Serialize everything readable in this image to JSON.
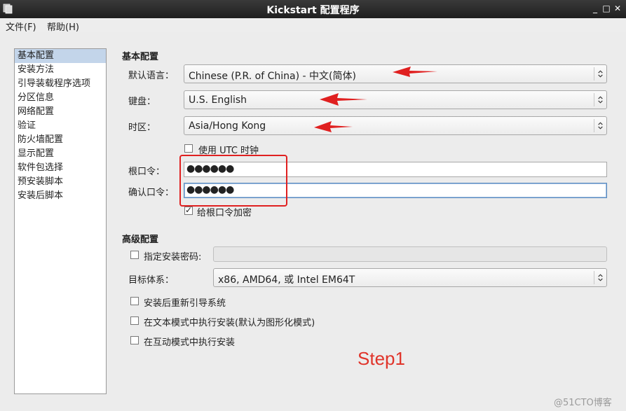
{
  "window": {
    "title": "Kickstart 配置程序",
    "controls": [
      "_",
      "□",
      "✕"
    ]
  },
  "menubar": {
    "file": "文件(F)",
    "help": "帮助(H)"
  },
  "sidebar": {
    "items": [
      "基本配置",
      "安装方法",
      "引导装载程序选项",
      "分区信息",
      "网络配置",
      "验证",
      "防火墙配置",
      "显示配置",
      "软件包选择",
      "预安装脚本",
      "安装后脚本"
    ],
    "selected_index": 0
  },
  "basic": {
    "section_title": "基本配置",
    "language_label": "默认语言：",
    "language_value": "Chinese (P.R. of China) - 中文(简体)",
    "keyboard_label": "键盘：",
    "keyboard_value": "U.S. English",
    "timezone_label": "时区：",
    "timezone_value": "Asia/Hong Kong",
    "utc_label": "使用 UTC 时钟",
    "utc_checked": false,
    "root_pw_label": "根口令：",
    "root_pw_value": "●●●●●●",
    "confirm_pw_label": "确认口令：",
    "confirm_pw_value": "●●●●●●",
    "encrypt_label": "给根口令加密",
    "encrypt_checked": true
  },
  "advanced": {
    "section_title": "高级配置",
    "install_key_label": "指定安装密码:",
    "install_key_checked": false,
    "target_arch_label": "目标体系：",
    "target_arch_value": "x86, AMD64, 或  Intel EM64T",
    "reboot_label": "安装后重新引导系统",
    "text_mode_label": "在文本模式中执行安装(默认为图形化模式)",
    "interactive_label": "在互动模式中执行安装"
  },
  "annotation": {
    "step_text": "Step1",
    "color": "#e02020"
  },
  "watermark": "@51CTO博客"
}
